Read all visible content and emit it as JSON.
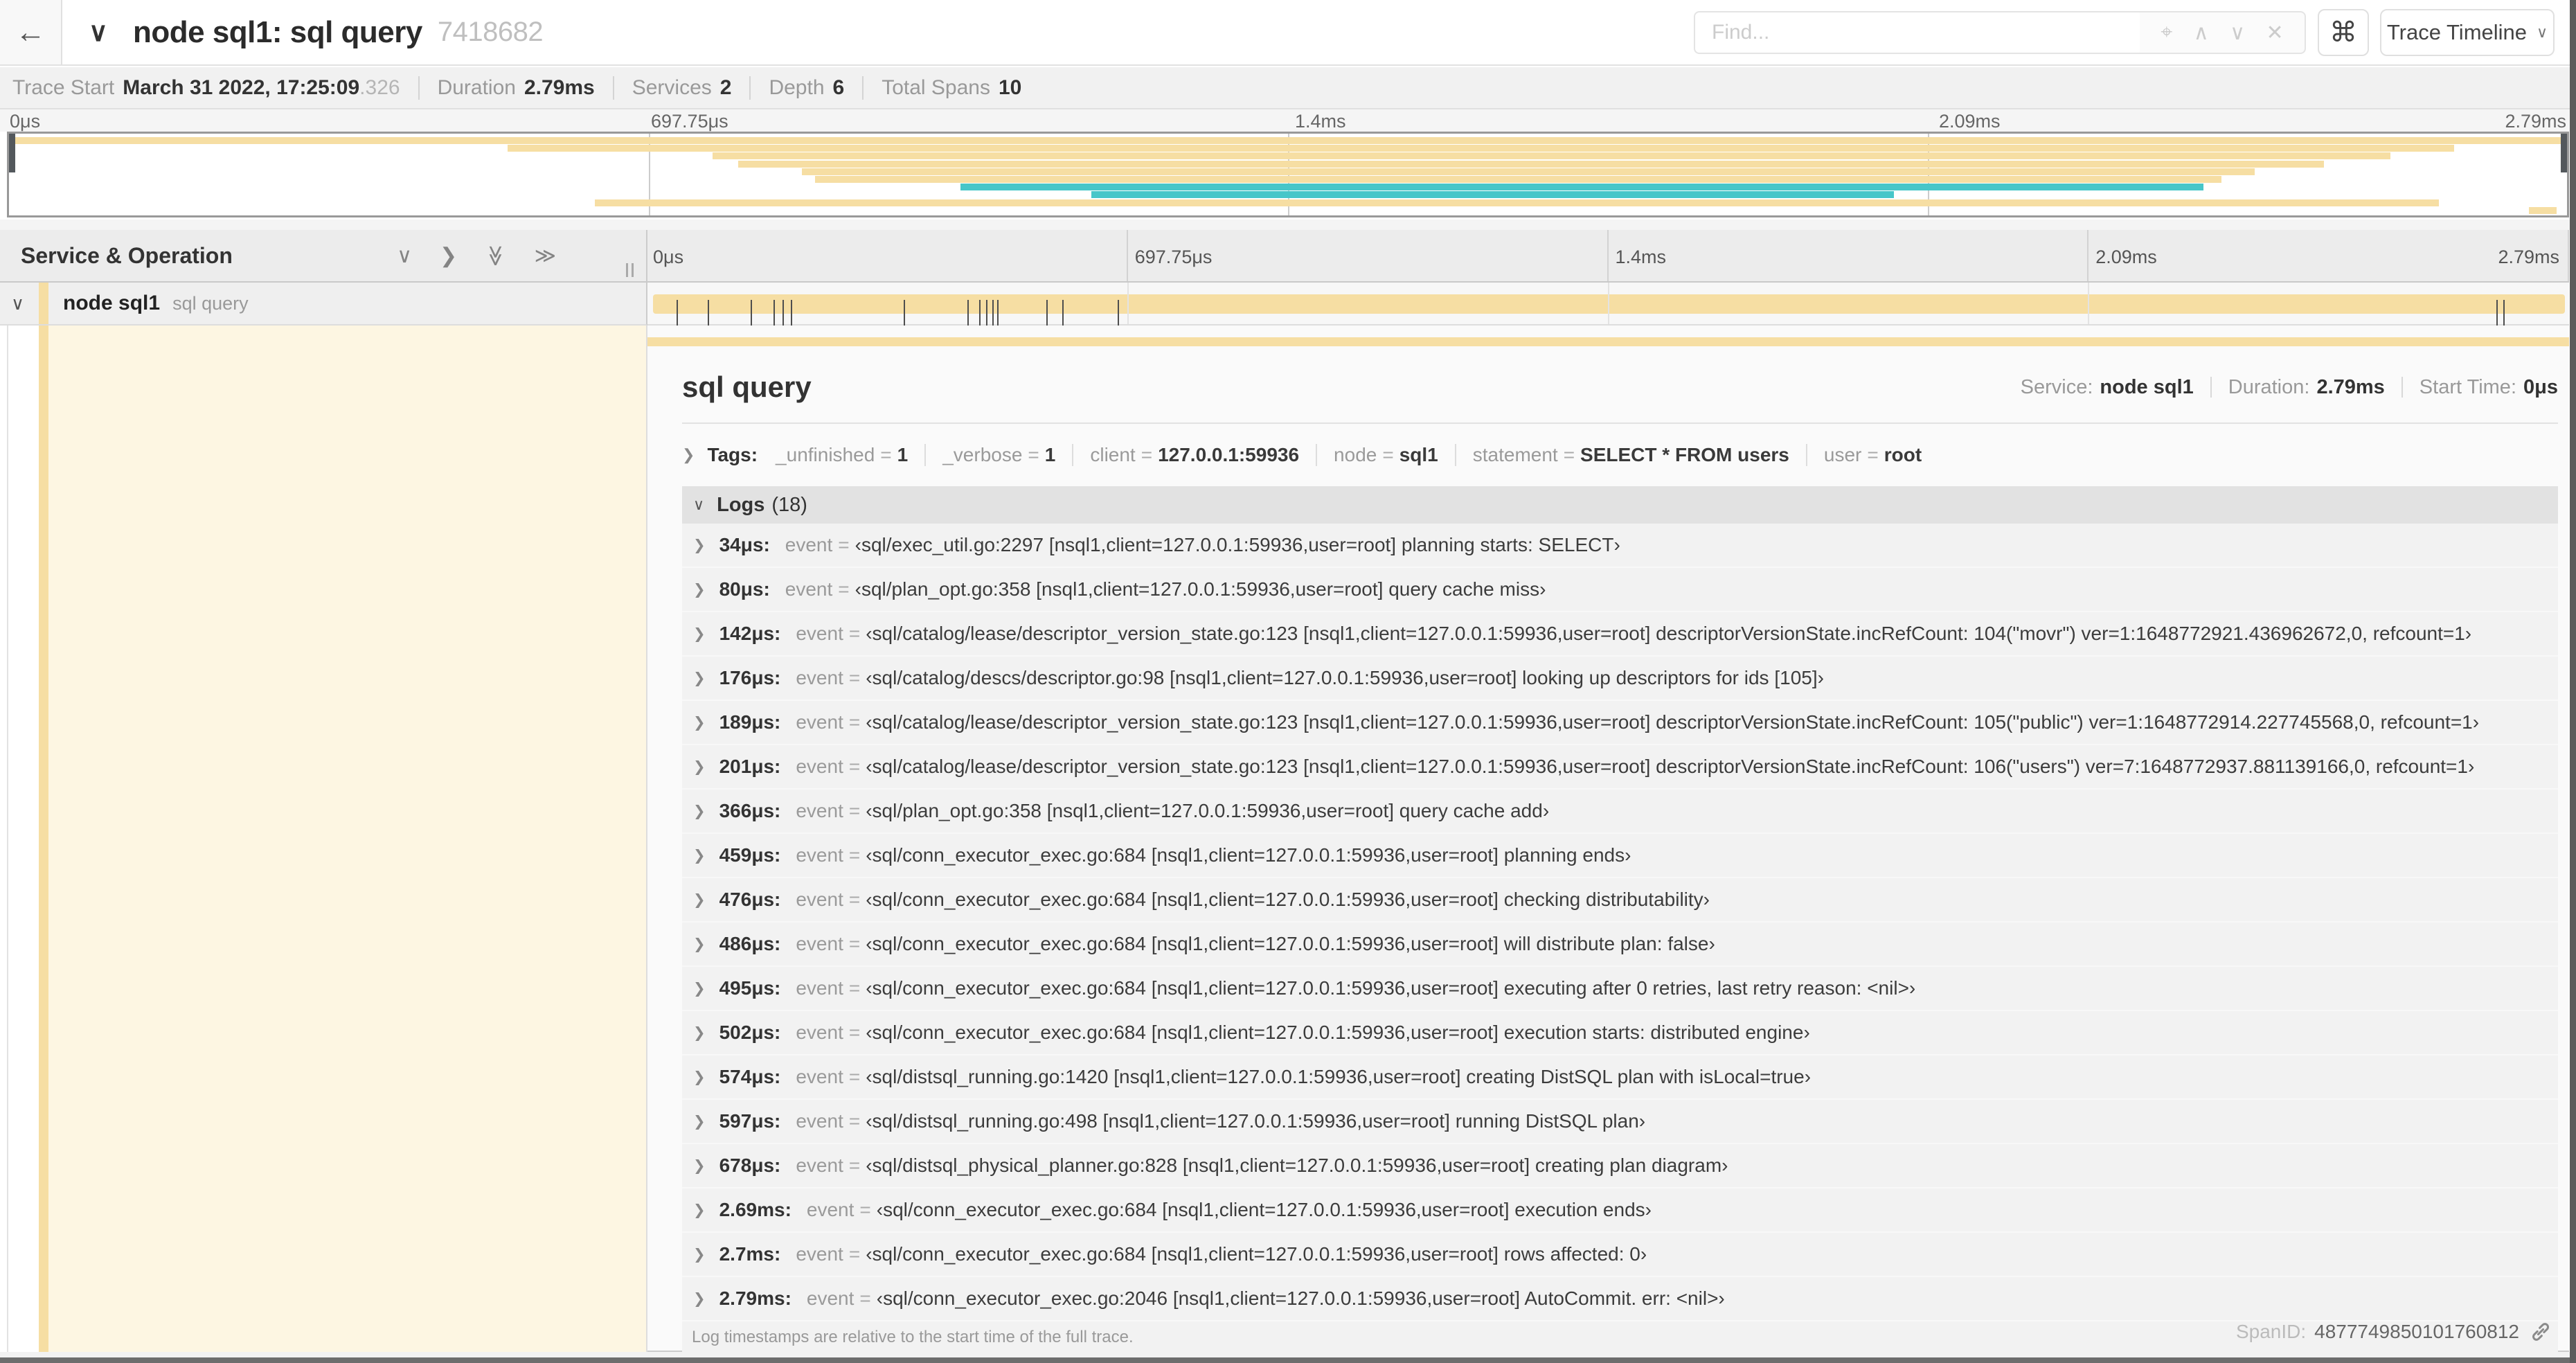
{
  "topbar": {
    "back_icon": "←",
    "collapse_caret_icon": "∨",
    "title": "node sql1: sql query",
    "trace_id": "7418682",
    "find_placeholder": "Find...",
    "locate_icon": "⌖",
    "prev_icon": "∧",
    "next_icon": "∨",
    "clear_icon": "✕",
    "shortcut_icon": "⌘",
    "view_selector_label": "Trace Timeline",
    "view_selector_caret": "∨"
  },
  "summary": {
    "items": [
      {
        "label": "Trace Start",
        "value": "March 31 2022, 17:25:09",
        "suffix": ".326"
      },
      {
        "label": "Duration",
        "value": "2.79ms"
      },
      {
        "label": "Services",
        "value": "2"
      },
      {
        "label": "Depth",
        "value": "6"
      },
      {
        "label": "Total Spans",
        "value": "10"
      }
    ]
  },
  "minimap": {
    "ticks": [
      "0μs",
      "697.75μs",
      "1.4ms",
      "2.09ms",
      "2.79ms"
    ],
    "colors": {
      "tan": "#f6dea3",
      "teal": "#47c6c9"
    },
    "spans": [
      {
        "start": 0,
        "end": 100,
        "color": "tan"
      },
      {
        "start": 19.5,
        "end": 95.6,
        "color": "tan"
      },
      {
        "start": 27.5,
        "end": 93.1,
        "color": "tan"
      },
      {
        "start": 28.5,
        "end": 90.5,
        "color": "tan"
      },
      {
        "start": 31.0,
        "end": 87.8,
        "color": "tan"
      },
      {
        "start": 31.5,
        "end": 86.5,
        "color": "tan"
      },
      {
        "start": 37.2,
        "end": 85.8,
        "color": "teal"
      },
      {
        "start": 42.3,
        "end": 73.7,
        "color": "teal"
      },
      {
        "start": 22.9,
        "end": 95.0,
        "color": "tan"
      },
      {
        "start": 98.5,
        "end": 99.6,
        "color": "tan"
      }
    ]
  },
  "timeline": {
    "left_header": "Service & Operation",
    "collapse_icons": [
      "chevron-down",
      "chevron-right",
      "double-chevron-down",
      "double-chevron-right"
    ],
    "ticks": [
      "0μs",
      "697.75μs",
      "1.4ms",
      "2.09ms",
      "2.79ms"
    ],
    "row": {
      "service": "node sql1",
      "operation": "sql query"
    },
    "total_duration_us": 2790
  },
  "detail": {
    "title": "sql query",
    "meta": [
      {
        "label": "Service:",
        "value": "node sql1"
      },
      {
        "label": "Duration:",
        "value": "2.79ms"
      },
      {
        "label": "Start Time:",
        "value": "0μs"
      }
    ],
    "tags_label": "Tags:",
    "tags": [
      {
        "key": "_unfinished",
        "value": "1"
      },
      {
        "key": "_verbose",
        "value": "1"
      },
      {
        "key": "client",
        "value": "127.0.0.1:59936"
      },
      {
        "key": "node",
        "value": "sql1"
      },
      {
        "key": "statement",
        "value": "SELECT * FROM users"
      },
      {
        "key": "user",
        "value": "root"
      }
    ],
    "logs_label": "Logs",
    "logs_count": "(18)",
    "logs": [
      {
        "time": "34μs",
        "key": "event",
        "value": "‹sql/exec_util.go:2297 [nsql1,client=127.0.0.1:59936,user=root] planning starts: SELECT›"
      },
      {
        "time": "80μs",
        "key": "event",
        "value": "‹sql/plan_opt.go:358 [nsql1,client=127.0.0.1:59936,user=root] query cache miss›"
      },
      {
        "time": "142μs",
        "key": "event",
        "value": "‹sql/catalog/lease/descriptor_version_state.go:123 [nsql1,client=127.0.0.1:59936,user=root] descriptorVersionState.incRefCount: 104(\"movr\") ver=1:1648772921.436962672,0, refcount=1›"
      },
      {
        "time": "176μs",
        "key": "event",
        "value": "‹sql/catalog/descs/descriptor.go:98 [nsql1,client=127.0.0.1:59936,user=root] looking up descriptors for ids [105]›"
      },
      {
        "time": "189μs",
        "key": "event",
        "value": "‹sql/catalog/lease/descriptor_version_state.go:123 [nsql1,client=127.0.0.1:59936,user=root] descriptorVersionState.incRefCount: 105(\"public\") ver=1:1648772914.227745568,0, refcount=1›"
      },
      {
        "time": "201μs",
        "key": "event",
        "value": "‹sql/catalog/lease/descriptor_version_state.go:123 [nsql1,client=127.0.0.1:59936,user=root] descriptorVersionState.incRefCount: 106(\"users\") ver=7:1648772937.881139166,0, refcount=1›"
      },
      {
        "time": "366μs",
        "key": "event",
        "value": "‹sql/plan_opt.go:358 [nsql1,client=127.0.0.1:59936,user=root] query cache add›"
      },
      {
        "time": "459μs",
        "key": "event",
        "value": "‹sql/conn_executor_exec.go:684 [nsql1,client=127.0.0.1:59936,user=root] planning ends›"
      },
      {
        "time": "476μs",
        "key": "event",
        "value": "‹sql/conn_executor_exec.go:684 [nsql1,client=127.0.0.1:59936,user=root] checking distributability›"
      },
      {
        "time": "486μs",
        "key": "event",
        "value": "‹sql/conn_executor_exec.go:684 [nsql1,client=127.0.0.1:59936,user=root] will distribute plan: false›"
      },
      {
        "time": "495μs",
        "key": "event",
        "value": "‹sql/conn_executor_exec.go:684 [nsql1,client=127.0.0.1:59936,user=root] executing after 0 retries, last retry reason: <nil>›"
      },
      {
        "time": "502μs",
        "key": "event",
        "value": "‹sql/conn_executor_exec.go:684 [nsql1,client=127.0.0.1:59936,user=root] execution starts: distributed engine›"
      },
      {
        "time": "574μs",
        "key": "event",
        "value": "‹sql/distsql_running.go:1420 [nsql1,client=127.0.0.1:59936,user=root] creating DistSQL plan with isLocal=true›"
      },
      {
        "time": "597μs",
        "key": "event",
        "value": "‹sql/distsql_running.go:498 [nsql1,client=127.0.0.1:59936,user=root] running DistSQL plan›"
      },
      {
        "time": "678μs",
        "key": "event",
        "value": "‹sql/distsql_physical_planner.go:828 [nsql1,client=127.0.0.1:59936,user=root] creating plan diagram›"
      },
      {
        "time": "2.69ms",
        "key": "event",
        "value": "‹sql/conn_executor_exec.go:684 [nsql1,client=127.0.0.1:59936,user=root] execution ends›"
      },
      {
        "time": "2.7ms",
        "key": "event",
        "value": "‹sql/conn_executor_exec.go:684 [nsql1,client=127.0.0.1:59936,user=root] rows affected: 0›"
      },
      {
        "time": "2.79ms",
        "key": "event",
        "value": "‹sql/conn_executor_exec.go:2046 [nsql1,client=127.0.0.1:59936,user=root] AutoCommit. err: <nil>›"
      }
    ],
    "logs_note": "Log timestamps are relative to the start time of the full trace.",
    "span_id_label": "SpanID:",
    "span_id": "4877749850101760812"
  }
}
